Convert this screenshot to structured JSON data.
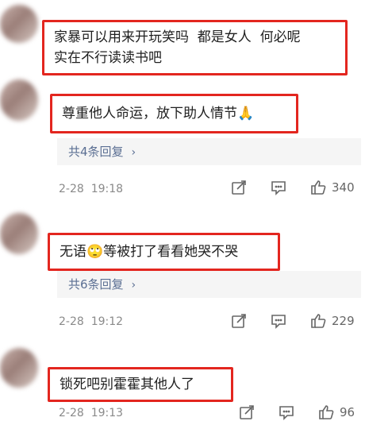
{
  "comments": [
    {
      "text": "家暴可以用来开玩笑吗  都是女人  何必呢\n实在不行读读书吧"
    },
    {
      "text": "尊重他人命运，放下助人情节",
      "emoji": "🙏",
      "replies_label": "共4条回复",
      "date": "2-28",
      "time": "19:18",
      "likes": "340"
    },
    {
      "text_before": "无语",
      "emoji": "🙄",
      "text_after": "等被打了看看她哭不哭",
      "replies_label": "共6条回复",
      "date": "2-28",
      "time": "19:12",
      "likes": "229"
    },
    {
      "text": "锁死吧别霍霍其他人了",
      "date": "2-28",
      "time": "19:13",
      "likes": "96"
    }
  ],
  "colors": {
    "highlight_border": "#e3261f",
    "reply_link": "#5b6f93",
    "meta_text": "#8a8a8a"
  },
  "icons": {
    "share": "share-icon",
    "comment": "comment-icon",
    "like": "thumbs-up-icon",
    "expand": "chevron-right-icon"
  }
}
